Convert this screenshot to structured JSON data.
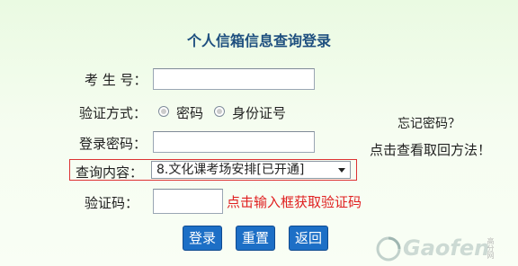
{
  "page": {
    "title": "个人信箱信息查询登录"
  },
  "form": {
    "candidate_label": "考 生 号：",
    "verify_method_label": "验证方式：",
    "verify_options": [
      {
        "label": "密码"
      },
      {
        "label": "身份证号"
      }
    ],
    "password_label": "登录密码：",
    "query_label": "查询内容：",
    "query_selected": "8.文化课考场安排[已开通]",
    "captcha_label": "验证码：",
    "captcha_hint": "点击输入框获取验证码"
  },
  "buttons": {
    "login": "登录",
    "reset": "重置",
    "back": "返回"
  },
  "side": {
    "forgot": "忘记密码？",
    "howto": "点击查看取回方法！"
  },
  "watermark": {
    "brand": "Gaofen",
    "site": "高分网"
  }
}
